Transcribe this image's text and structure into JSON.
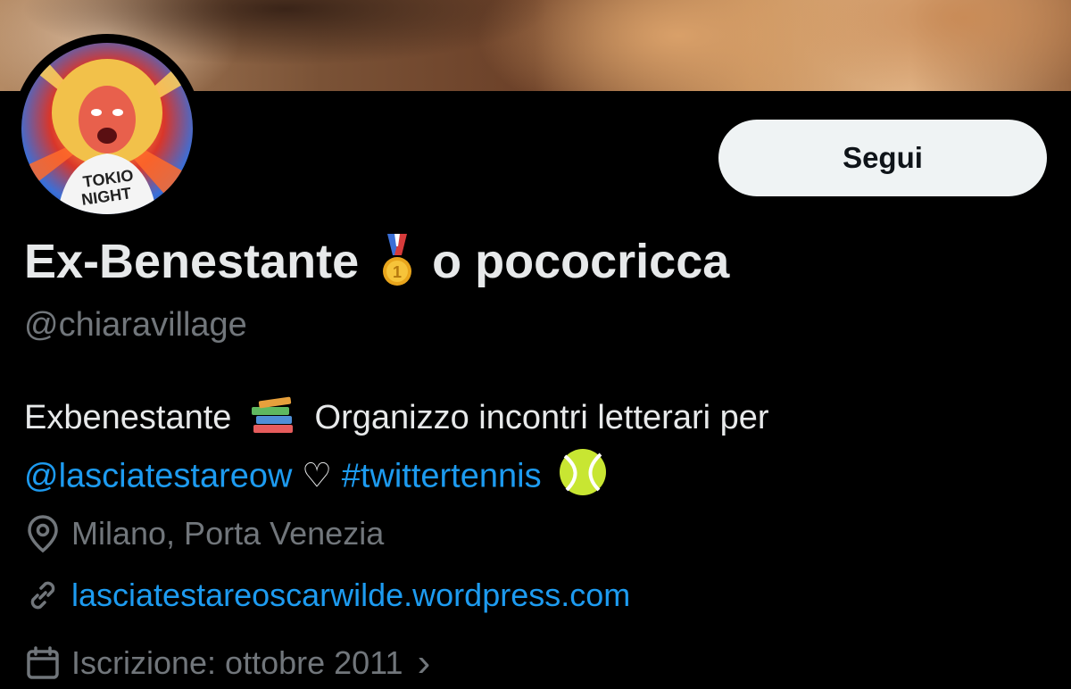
{
  "profile": {
    "display_name_part1": "Ex-Benestante",
    "display_name_part2": "o pococricca",
    "medal_icon": "first-place-medal-icon",
    "handle": "@chiaravillage",
    "follow_label": "Segui",
    "avatar_text_line1": "TOKIO",
    "avatar_text_line2": "NIGHT"
  },
  "bio": {
    "text1": "Exbenestante",
    "books_icon": "books-icon",
    "text2": "Organizzo incontri letterari per",
    "mention": "@lasciatestareow",
    "heart": "♡",
    "hashtag": "#twittertennis",
    "tennis_icon": "tennis-ball-icon"
  },
  "meta": {
    "location": "Milano, Porta Venezia",
    "website": "lasciatestareoscarwilde.wordpress.com",
    "joined": "Iscrizione: ottobre 2011",
    "chevron": "›"
  },
  "colors": {
    "background": "#000000",
    "text_primary": "#e7e9ea",
    "text_secondary": "#71767b",
    "link": "#1d9bf0",
    "button_bg": "#eff3f4"
  }
}
